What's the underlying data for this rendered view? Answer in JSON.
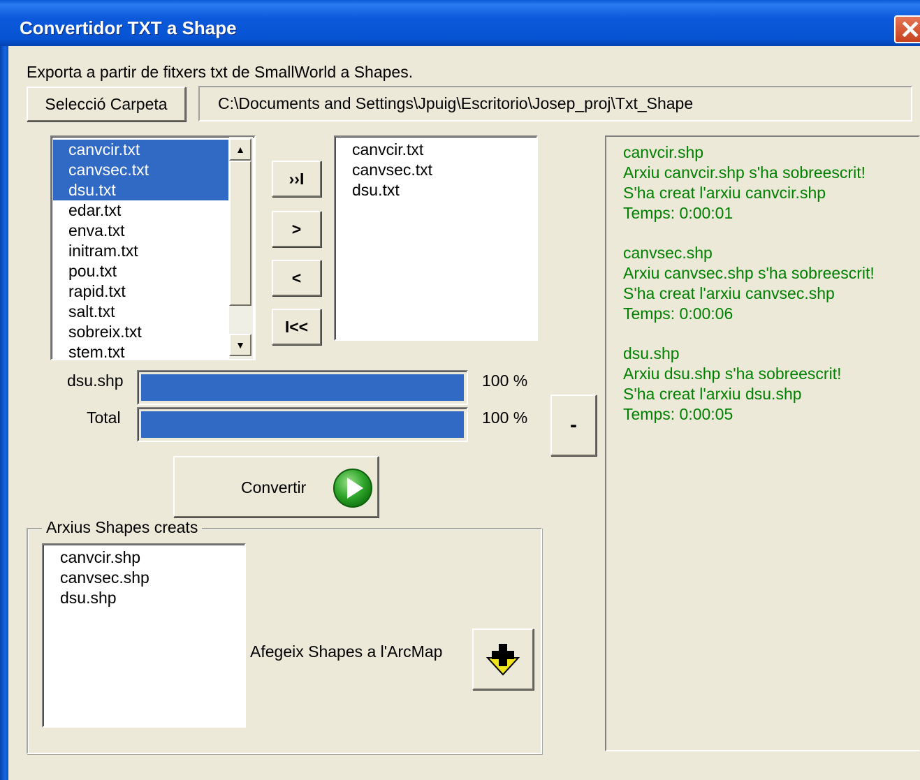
{
  "window": {
    "title": "Convertidor TXT a Shape",
    "close_glyph": "✕"
  },
  "intro_text": "Exporta a partir de fitxers txt de SmallWorld a Shapes.",
  "folder": {
    "button_label": "Selecció Carpeta",
    "path": "C:\\Documents and Settings\\Jpuig\\Escritorio\\Josep_proj\\Txt_Shape"
  },
  "source_list": {
    "items": [
      {
        "label": "canvcir.txt",
        "selected": true
      },
      {
        "label": "canvsec.txt",
        "selected": true
      },
      {
        "label": "dsu.txt",
        "selected": true
      },
      {
        "label": "edar.txt",
        "selected": false
      },
      {
        "label": "enva.txt",
        "selected": false
      },
      {
        "label": "initram.txt",
        "selected": false
      },
      {
        "label": "pou.txt",
        "selected": false
      },
      {
        "label": "rapid.txt",
        "selected": false
      },
      {
        "label": "salt.txt",
        "selected": false
      },
      {
        "label": "sobreix.txt",
        "selected": false
      },
      {
        "label": "stem.txt",
        "selected": false
      }
    ]
  },
  "transfer_buttons": {
    "add_all": "››I",
    "add": ">",
    "remove": "<",
    "remove_all": "I<<"
  },
  "target_list": {
    "items": [
      "canvcir.txt",
      "canvsec.txt",
      "dsu.txt"
    ]
  },
  "progress": {
    "current_label": "dsu.shp",
    "current_percent": "100 %",
    "current_value": 1.0,
    "total_label": "Total",
    "total_percent": "100 %",
    "total_value": 1.0
  },
  "convert_button": {
    "label": "Convertir",
    "icon": "play-icon",
    "icon_color": "#2fa62b"
  },
  "collapse_button": {
    "label": "-"
  },
  "log": {
    "color": "#008000",
    "entries": [
      {
        "lines": [
          "canvcir.shp",
          "Arxiu canvcir.shp s'ha sobreescrit!",
          "S'ha creat l'arxiu canvcir.shp",
          "Temps: 0:00:01"
        ]
      },
      {
        "lines": [
          "canvsec.shp",
          "Arxiu canvsec.shp s'ha sobreescrit!",
          "S'ha creat l'arxiu canvsec.shp",
          "Temps: 0:00:06"
        ]
      },
      {
        "lines": [
          "dsu.shp",
          "Arxiu dsu.shp s'ha sobreescrit!",
          "S'ha creat l'arxiu dsu.shp",
          "Temps: 0:00:05"
        ]
      }
    ]
  },
  "created_group": {
    "title": "Arxius Shapes creats",
    "items": [
      "canvcir.shp",
      "canvsec.shp",
      "dsu.shp"
    ],
    "add_label": "Afegeix Shapes a l'ArcMap",
    "add_icon": "add-layer-icon"
  }
}
